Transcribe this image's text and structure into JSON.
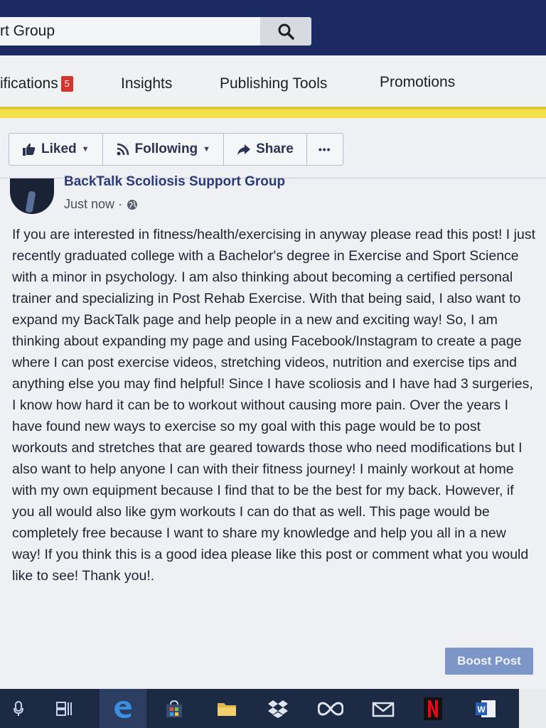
{
  "search": {
    "value": "rt Group"
  },
  "nav": {
    "notifications": "ifications",
    "notifications_count": "5",
    "insights": "Insights",
    "publishing_tools": "Publishing Tools",
    "promotions": "Promotions"
  },
  "actions": {
    "liked": "Liked",
    "following": "Following",
    "share": "Share",
    "more": "•••"
  },
  "post": {
    "page_name": "BackTalk Scoliosis Support Group",
    "time": "Just now ·",
    "body": "If you are interested in fitness/health/exercising in anyway please read this post! I just recently graduated college with a Bachelor's degree in Exercise and Sport Science with a minor in psychology. I am also thinking about becoming a certified personal trainer and specializing in Post Rehab Exercise. With that being said, I also want to expand my BackTalk page and help people in a new and exciting way! So, I am thinking about expanding my page and using Facebook/Instagram to create a page where I can post exercise videos, stretching videos, nutrition and exercise tips and anything else you may find helpful! Since I have scoliosis and I have had 3 surgeries, I know how hard it can be to workout without causing more pain. Over the years I have found new ways to exercise so my goal with this page would be to post workouts and stretches that are geared towards those who need modifications but I also want to help anyone I can with their fitness journey! I mainly workout at home with my own equipment because I find that to be the best for my back. However, if you all would also like gym workouts I can do that as well. This page would be completely free because I want to share my knowledge and help you all in a new way! If you think this is a good idea please like this post or comment what you would like to see! Thank you!.",
    "boost_label": "Boost Post"
  },
  "taskbar": {
    "icons": [
      "microphone-icon",
      "task-view-icon",
      "edge-browser-icon",
      "store-icon",
      "file-explorer-icon",
      "dropbox-icon",
      "infinity-icon",
      "mail-icon",
      "netflix-icon",
      "word-icon"
    ]
  },
  "colors": {
    "topbar": "#1b2a63",
    "accent_yellow": "#f2e04a",
    "badge_red": "#d9342b",
    "boost_blue": "#7d96c8"
  }
}
